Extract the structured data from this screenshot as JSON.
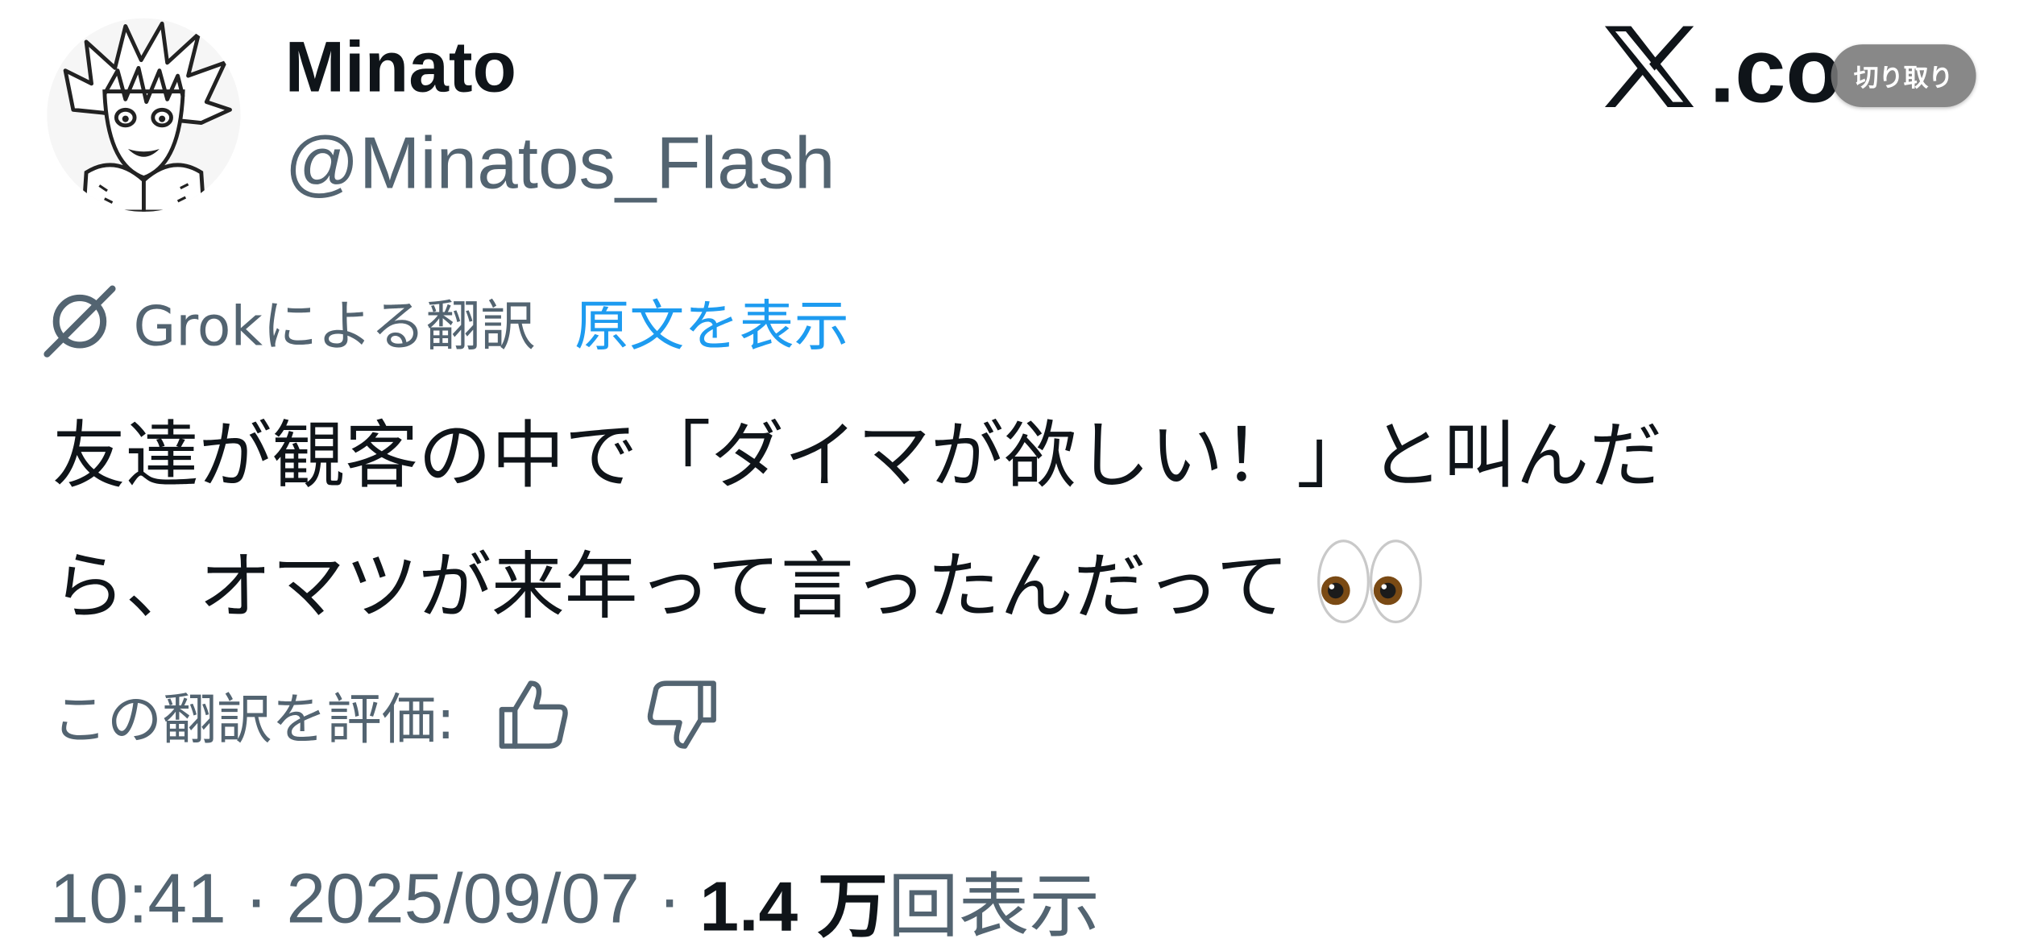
{
  "author": {
    "display_name": "Minato",
    "handle": "@Minatos_Flash",
    "avatar_icon": "anime-character-avatar"
  },
  "brand": {
    "logo_icon": "x-logo-icon",
    "suffix_visible": ".co"
  },
  "overlay": {
    "snip_label": "切り取り"
  },
  "translation": {
    "icon": "grok-icon",
    "translated_by": "Grokによる翻訳",
    "show_original": "原文を表示"
  },
  "tweet": {
    "line1": "友達が観客の中で「ダイマが欲しい！」と叫んだ",
    "line2": "ら、オマツが来年って言ったんだって",
    "emoji": "eyes-emoji"
  },
  "rating": {
    "label": "この翻訳を評価:",
    "like_icon": "thumbs-up-icon",
    "dislike_icon": "thumbs-down-icon"
  },
  "meta": {
    "time": "10:41",
    "separator": "·",
    "date": "2025/09/07",
    "views_count": "1.4 万",
    "views_label": "回表示"
  },
  "colors": {
    "text": "#0f1419",
    "secondary": "#536471",
    "link": "#1d9bf0"
  }
}
